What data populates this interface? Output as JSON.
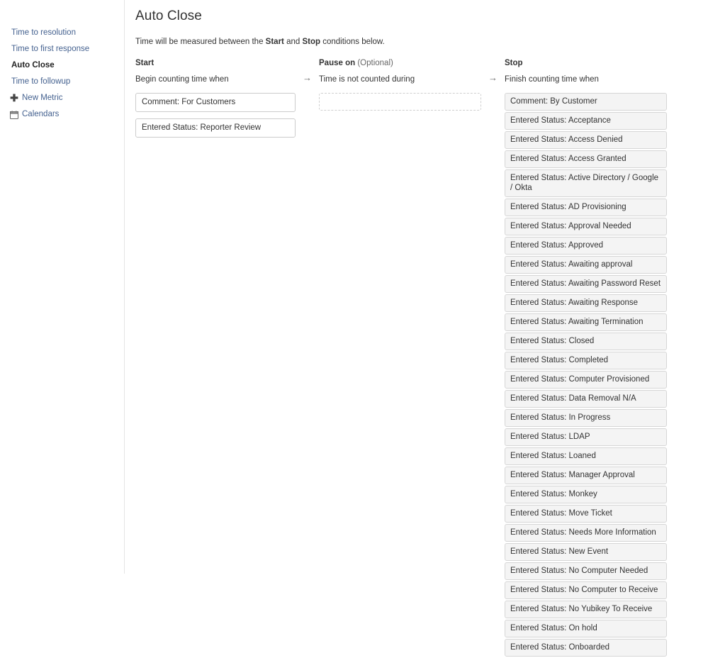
{
  "sidebar": {
    "items": [
      {
        "label": "Time to resolution",
        "active": false,
        "icon": null
      },
      {
        "label": "Time to first response",
        "active": false,
        "icon": null
      },
      {
        "label": "Auto Close",
        "active": true,
        "icon": null
      },
      {
        "label": "Time to followup",
        "active": false,
        "icon": null
      },
      {
        "label": "New Metric",
        "active": false,
        "icon": "plus-icon"
      },
      {
        "label": "Calendars",
        "active": false,
        "icon": "calendar-icon"
      }
    ]
  },
  "main": {
    "title": "Auto Close",
    "intro": {
      "prefix": "Time will be measured between the ",
      "bold1": "Start",
      "middle": " and ",
      "bold2": "Stop",
      "suffix": " conditions below."
    },
    "arrow_glyph": "→",
    "columns": {
      "start": {
        "title": "Start",
        "subtitle": "Begin counting time when",
        "chips": [
          "Comment: For Customers",
          "Entered Status: Reporter Review"
        ]
      },
      "pause": {
        "title": "Pause on",
        "optional": "(Optional)",
        "subtitle": "Time is not counted during",
        "chips": []
      },
      "stop": {
        "title": "Stop",
        "subtitle": "Finish counting time when",
        "items": [
          "Comment: By Customer",
          "Entered Status: Acceptance",
          "Entered Status: Access Denied",
          "Entered Status: Access Granted",
          "Entered Status: Active Directory / Google / Okta",
          "Entered Status: AD Provisioning",
          "Entered Status: Approval Needed",
          "Entered Status: Approved",
          "Entered Status: Awaiting approval",
          "Entered Status: Awaiting Password Reset",
          "Entered Status: Awaiting Response",
          "Entered Status: Awaiting Termination",
          "Entered Status: Closed",
          "Entered Status: Completed",
          "Entered Status: Computer Provisioned",
          "Entered Status: Data Removal N/A",
          "Entered Status: In Progress",
          "Entered Status: LDAP",
          "Entered Status: Loaned",
          "Entered Status: Manager Approval",
          "Entered Status: Monkey",
          "Entered Status: Move Ticket",
          "Entered Status: Needs More Information",
          "Entered Status: New Event",
          "Entered Status: No Computer Needed",
          "Entered Status: No Computer to Receive",
          "Entered Status: No Yubikey To Receive",
          "Entered Status: On hold",
          "Entered Status: Onboarded"
        ]
      }
    }
  },
  "colors": {
    "link": "#44618f",
    "text": "#333333",
    "item_bg": "#f4f4f4",
    "item_border": "#d6d6d6",
    "divider": "#e4e4e4"
  }
}
